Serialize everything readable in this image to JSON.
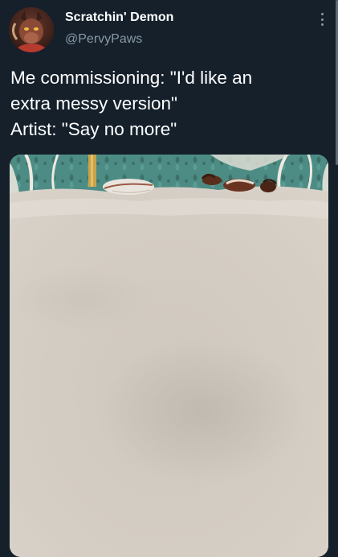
{
  "tweet": {
    "author": {
      "display_name": "Scratchin' Demon",
      "handle": "@PervyPaws",
      "avatar_icon": "demon-avatar"
    },
    "more_icon": "more-options-icon",
    "text_lines": [
      "Me commissioning: \"I'd like an",
      "extra messy version\"",
      "Artist: \"Say no more\""
    ],
    "media": {
      "type": "image",
      "colors": {
        "wallpaper": "#4d8c84",
        "cream": "#d4cdc4"
      }
    }
  },
  "colors": {
    "background": "#15202b",
    "primary_text": "#ffffff",
    "secondary_text": "#8899a6"
  }
}
